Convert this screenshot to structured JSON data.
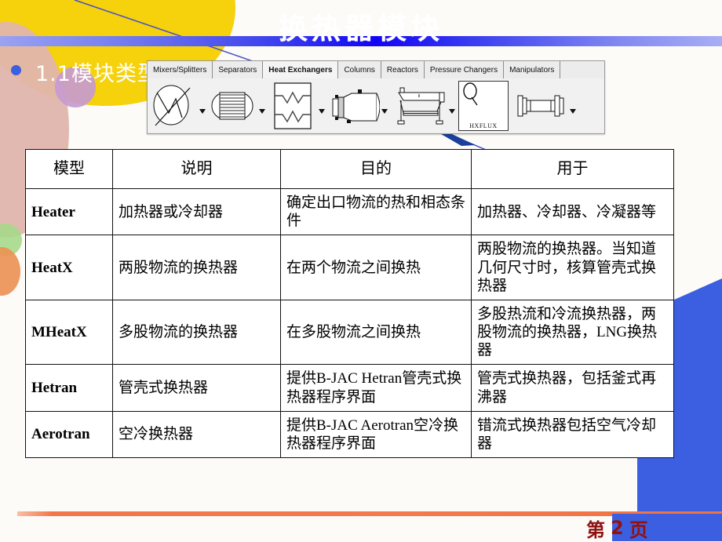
{
  "slide": {
    "title": "换热器模块",
    "bullet": "1.1模块类型",
    "page_label_prefix": "第",
    "page_number": "2",
    "page_label_suffix": "页"
  },
  "colors": {
    "title_bar_accent": "#1205f5",
    "bullet_dot": "#3b5fe0",
    "footer_rule": "#f2764a",
    "page_box": "#3b5fe0",
    "page_text": "#8e1212",
    "deco_yellow": "#f5d20c",
    "deco_pink": "#e0b5ad",
    "deco_purple": "#c79ad0",
    "deco_green": "#a6d989",
    "deco_orange": "#eb9355"
  },
  "palette": {
    "tabs": [
      {
        "label": "Mixers/Splitters",
        "selected": false
      },
      {
        "label": "Separators",
        "selected": false
      },
      {
        "label": "Heat Exchangers",
        "selected": true
      },
      {
        "label": "Columns",
        "selected": false
      },
      {
        "label": "Reactors",
        "selected": false
      },
      {
        "label": "Pressure Changers",
        "selected": false
      },
      {
        "label": "Manipulators",
        "selected": false
      }
    ],
    "icons": [
      {
        "name": "heater-icon",
        "label": ""
      },
      {
        "name": "heatx-icon",
        "label": ""
      },
      {
        "name": "mheatx-icon",
        "label": ""
      },
      {
        "name": "hetran-icon",
        "label": ""
      },
      {
        "name": "aerotran-icon",
        "label": ""
      },
      {
        "name": "hxflux-icon",
        "label": "HXFLUX"
      },
      {
        "name": "hxfvsa-icon",
        "label": ""
      }
    ],
    "hxflux_label": "HXFLUX",
    "hxflux_symbol": "Q"
  },
  "table": {
    "headers": [
      "模型",
      "说明",
      "目的",
      "用于"
    ],
    "rows": [
      {
        "model": "Heater",
        "description": "加热器或冷却器",
        "purpose": "确定出口物流的热和相态条件",
        "usage": "加热器、冷却器、冷凝器等"
      },
      {
        "model": "HeatX",
        "description": "两股物流的换热器",
        "purpose": "在两个物流之间换热",
        "usage": "两股物流的换热器。当知道几何尺寸时，核算管壳式换热器"
      },
      {
        "model": "MHeatX",
        "description": "多股物流的换热器",
        "purpose": "在多股物流之间换热",
        "usage": "多股热流和冷流换热器，两股物流的换热器，LNG换热器"
      },
      {
        "model": "Hetran",
        "description": "管壳式换热器",
        "purpose": "提供B-JAC Hetran管壳式换热器程序界面",
        "usage": "管壳式换热器，包括釜式再沸器"
      },
      {
        "model": "Aerotran",
        "description": "空冷换热器",
        "purpose": "提供B-JAC Aerotran空冷换热器程序界面",
        "usage": "错流式换热器包括空气冷却器"
      }
    ]
  }
}
